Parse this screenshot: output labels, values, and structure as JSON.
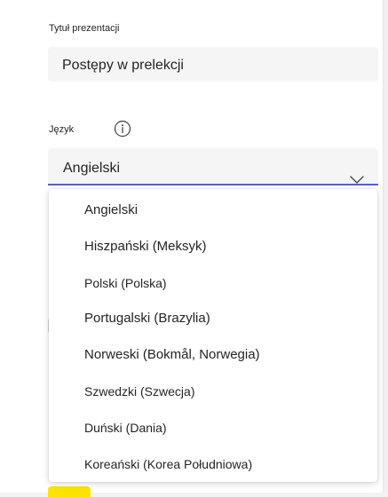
{
  "form": {
    "title_label": "Tytuł prezentacji",
    "title_value": "Postępy w prelekcji",
    "language_label": "Język",
    "info_icon": "info-circle-icon",
    "language_value": "Angielski",
    "chevron_icon": "chevron-down-icon"
  },
  "dropdown": {
    "options": [
      "Angielski",
      "Hiszpański (Meksyk)",
      "Polski (Polska)",
      "Portugalski (Brazylia)",
      "Norweski (Bokmål, Norwegia)",
      "Szwedzki (Szwecja)",
      "Duński (Dania)",
      "Koreański (Korea Południowa)"
    ]
  },
  "colors": {
    "accent_underline": "#5b5fc7",
    "button_yellow": "#fde300",
    "field_background": "#f5f5f5"
  }
}
